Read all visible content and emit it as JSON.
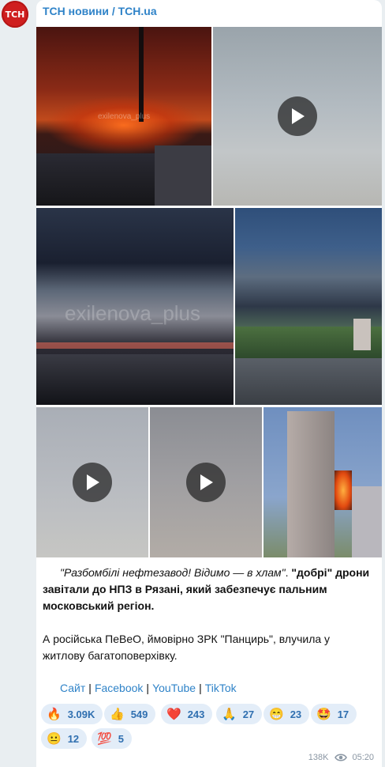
{
  "channel": {
    "avatar_text": "ТСН",
    "name": "ТСН новини / TCH.ua"
  },
  "media": [
    {
      "kind": "photo",
      "watermark": "exilenova_plus",
      "description": "night fire"
    },
    {
      "kind": "video"
    },
    {
      "kind": "photo",
      "watermark": "exilenova_plus",
      "description": "smoke over city"
    },
    {
      "kind": "photo",
      "description": "smoke cloud"
    },
    {
      "kind": "video"
    },
    {
      "kind": "video"
    },
    {
      "kind": "photo",
      "description": "burning building"
    }
  ],
  "post": {
    "quote": "\"Разбомбілі нефтезавод! Відимо — в хлам\"",
    "bold_1": "\"добрі\" дрони завітали до НПЗ в Рязані, який забезпечує пальним московський регіон.",
    "para_2": "А російська ПеВеО, ймовірно ЗРК \"Панцирь\", влучила у житлову багатоповерхівку."
  },
  "links": {
    "site": "Сайт",
    "facebook": "Facebook",
    "youtube": "YouTube",
    "tiktok": "TikTok",
    "sep": "|"
  },
  "reactions": [
    {
      "emoji": "🔥",
      "count": "3.09K"
    },
    {
      "emoji": "👍",
      "count": "549"
    },
    {
      "emoji": "❤️",
      "count": "243"
    },
    {
      "emoji": "🙏",
      "count": "27"
    },
    {
      "emoji": "😁",
      "count": "23"
    },
    {
      "emoji": "🤩",
      "count": "17"
    },
    {
      "emoji": "😐",
      "count": "12"
    },
    {
      "emoji": "💯",
      "count": "5"
    }
  ],
  "meta": {
    "views": "138K",
    "time": "05:20"
  },
  "colors": {
    "accent": "#2f83c8",
    "bubble": "#ffffff",
    "background": "#e9eef1"
  }
}
